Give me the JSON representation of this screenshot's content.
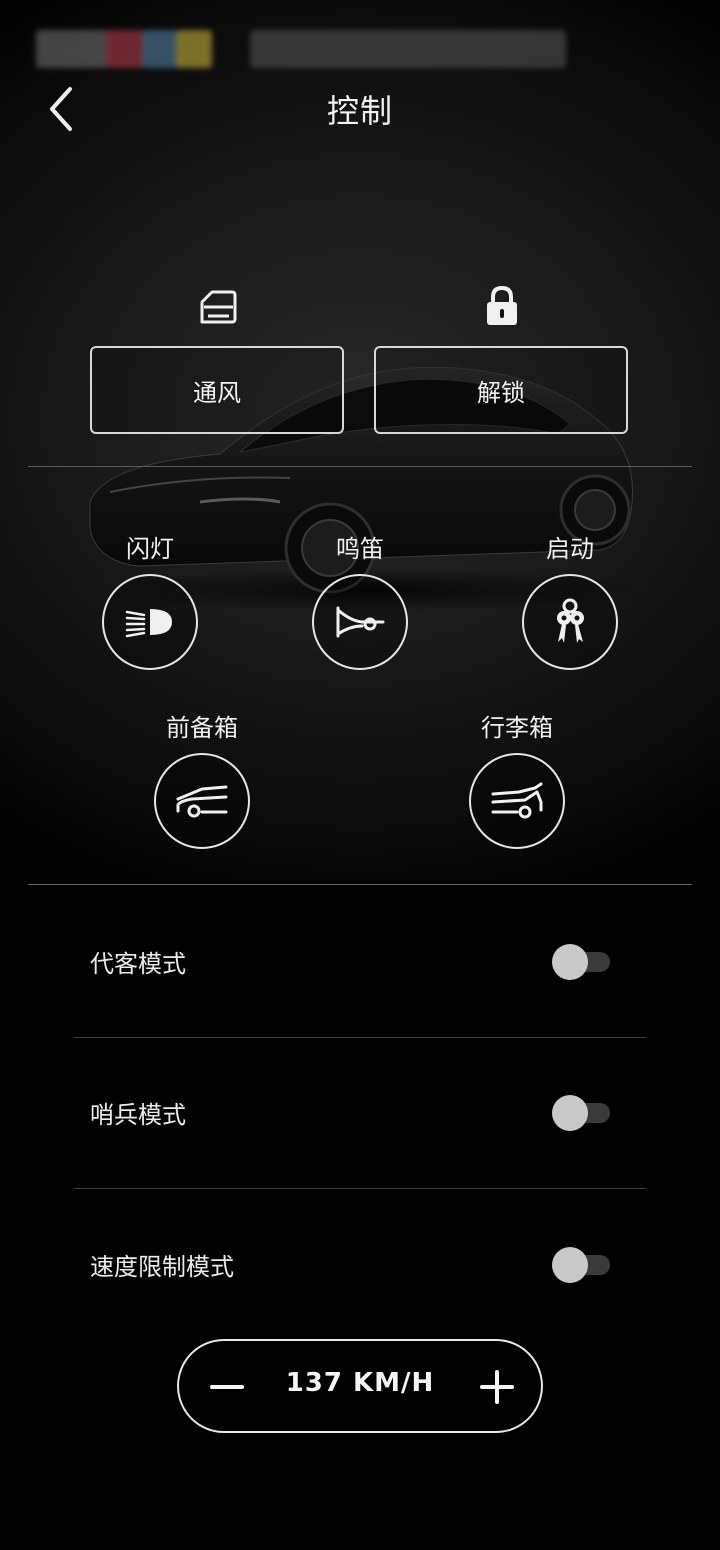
{
  "header": {
    "title": "控制"
  },
  "quick_actions": [
    {
      "icon": "window-icon",
      "label": "通风"
    },
    {
      "icon": "lock-icon",
      "label": "解锁"
    }
  ],
  "controls": [
    {
      "label": "闪灯",
      "icon": "headlight-icon"
    },
    {
      "label": "鸣笛",
      "icon": "horn-icon"
    },
    {
      "label": "启动",
      "icon": "keys-icon"
    },
    {
      "label": "前备箱",
      "icon": "frunk-icon"
    },
    {
      "label": "行李箱",
      "icon": "trunk-icon"
    }
  ],
  "settings": [
    {
      "label": "代客模式",
      "enabled": false
    },
    {
      "label": "哨兵模式",
      "enabled": false
    },
    {
      "label": "速度限制模式",
      "enabled": false
    }
  ],
  "speed_limit": {
    "value": "137 KM/H"
  },
  "colors": {
    "background": "#000000",
    "text": "#ffffff",
    "border": "#e6e6e6",
    "divider": "#5a5a5a",
    "toggle_off_knob": "#c9c9c9",
    "toggle_off_track": "#3a3a3a"
  }
}
